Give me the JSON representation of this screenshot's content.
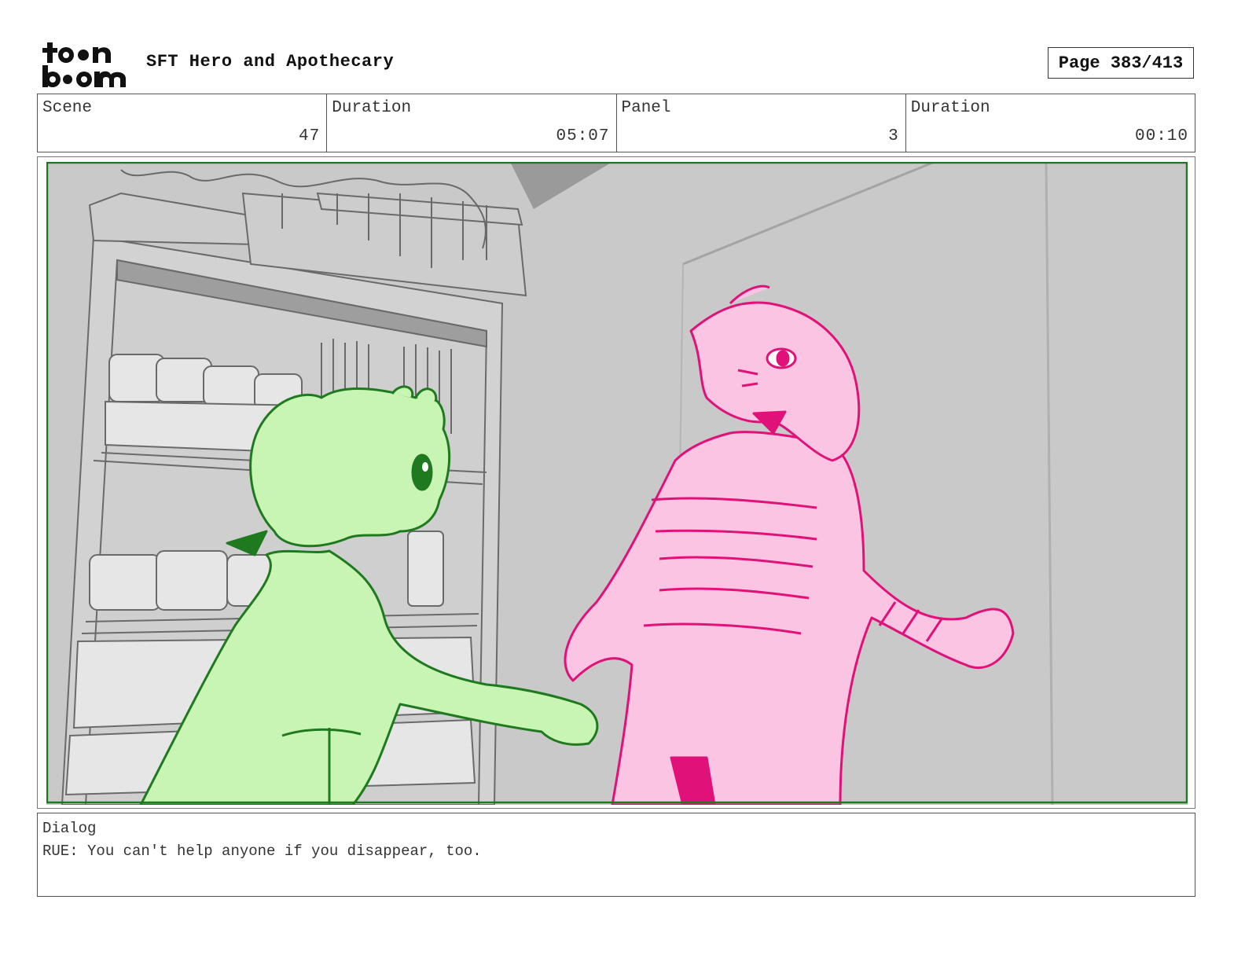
{
  "header": {
    "logo_text": "toon boom",
    "title": "SFT Hero and Apothecary",
    "page": "Page 383/413"
  },
  "info": {
    "scene_label": "Scene",
    "scene_value": "47",
    "duration_label": "Duration",
    "duration_value": "05:07",
    "panel_label": "Panel",
    "panel_value": "3",
    "panel_duration_label": "Duration",
    "panel_duration_value": "00:10"
  },
  "panel": {
    "characters": [
      "green-character",
      "pink-character"
    ],
    "colors": {
      "frame": "#1e7a1e",
      "green_fill": "#c8f5b4",
      "green_line": "#1f7a1f",
      "pink_fill": "#fbc4e2",
      "pink_line": "#e0127a",
      "background": "#c9c9c9"
    }
  },
  "dialog": {
    "label": "Dialog",
    "text": "RUE: You can't help anyone if you disappear, too."
  }
}
